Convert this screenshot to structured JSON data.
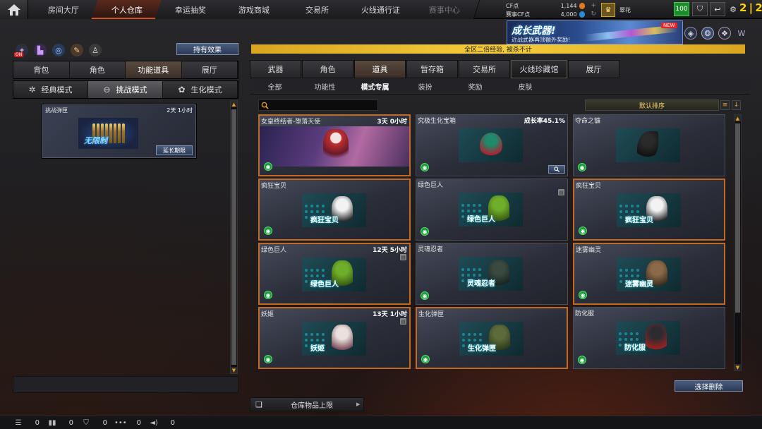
{
  "topnav": {
    "tabs": [
      {
        "label": "房间大厅"
      },
      {
        "label": "个人仓库"
      },
      {
        "label": "幸运抽奖"
      },
      {
        "label": "游戏商城"
      },
      {
        "label": "交易所"
      },
      {
        "label": "火线通行证"
      },
      {
        "label": "赛事中心"
      }
    ],
    "active_index": 1,
    "cf_label": "CF点",
    "cf_value": "1,144",
    "match_cf_label": "赛事CF点",
    "match_cf_value": "4,000",
    "username": "翠花",
    "level": "100",
    "counter": "2 | 2"
  },
  "banner": {
    "title": "成长武器!",
    "subtitle": "近战武器再顶额外奖励!",
    "new_tag": "NEW"
  },
  "ticker": "全区二倍经验, 被杀不计",
  "left": {
    "on_badge": "ON",
    "hold_button": "持有效果",
    "tabs": [
      "背包",
      "角色",
      "功能道具",
      "展厅"
    ],
    "active_tab": 2,
    "modes": [
      {
        "label": "经典模式",
        "icon": "classic-mode-icon",
        "glyph": "✲"
      },
      {
        "label": "挑战模式",
        "icon": "challenge-mode-icon",
        "glyph": "⊖"
      },
      {
        "label": "生化模式",
        "icon": "bio-mode-icon",
        "glyph": "✿"
      }
    ],
    "active_mode": 1,
    "item": {
      "name": "挑战弹匣",
      "time": "2天 1小时",
      "overlay": "无限制",
      "extend_button": "延长期限"
    }
  },
  "right": {
    "tabs": [
      "武器",
      "角色",
      "道具",
      "暂存箱",
      "交易所",
      "火线珍藏馆",
      "展厅"
    ],
    "active_tab": 2,
    "subtabs": [
      "全部",
      "功能性",
      "模式专属",
      "装扮",
      "奖励",
      "皮肤"
    ],
    "active_subtab": 2,
    "search_placeholder": "",
    "sort_label": "默认排序",
    "items": [
      {
        "name": "女皇终结者-堕落天使",
        "time": "3天 0小时",
        "highlight": true,
        "style": "wide",
        "caption": ""
      },
      {
        "name": "究极生化宝箱",
        "time": "成长率45.1%",
        "highlight": false,
        "style": "chest",
        "caption": "",
        "magnify": true
      },
      {
        "name": "夺命之镰",
        "time": "",
        "highlight": false,
        "style": "scythe",
        "caption": ""
      },
      {
        "name": "疯狂宝贝",
        "time": "",
        "highlight": true,
        "style": "char-pink",
        "caption": "疯狂宝贝"
      },
      {
        "name": "绿色巨人",
        "time": "",
        "highlight": false,
        "style": "char-green",
        "caption": "绿色巨人",
        "lock": true
      },
      {
        "name": "疯狂宝贝",
        "time": "",
        "highlight": true,
        "style": "char-pink",
        "caption": "疯狂宝贝"
      },
      {
        "name": "绿色巨人",
        "time": "12天 5小时",
        "highlight": true,
        "style": "char-green",
        "caption": "绿色巨人",
        "lock": true
      },
      {
        "name": "灵魂忍者",
        "time": "",
        "highlight": false,
        "style": "char-dark",
        "caption": "灵魂忍者"
      },
      {
        "name": "迷雾幽灵",
        "time": "",
        "highlight": true,
        "style": "char-brown",
        "caption": "迷雾幽灵"
      },
      {
        "name": "妖姬",
        "time": "13天 1小时",
        "highlight": true,
        "style": "char-white",
        "caption": "妖姬",
        "lock": true
      },
      {
        "name": "生化弹匣",
        "time": "",
        "highlight": true,
        "style": "ammo",
        "caption": "生化弹匣"
      },
      {
        "name": "防化服",
        "time": "",
        "highlight": false,
        "style": "suit",
        "caption": "防化服"
      }
    ],
    "delete_button": "选择删除",
    "capacity_label": "仓库物品上限"
  },
  "bottombar": [
    {
      "icon": "list-icon",
      "glyph": "☰",
      "value": "0"
    },
    {
      "icon": "binoculars-icon",
      "glyph": "▮▮",
      "value": "0"
    },
    {
      "icon": "shield-icon",
      "glyph": "⛉",
      "value": "0"
    },
    {
      "icon": "chat-icon",
      "glyph": "•••",
      "value": "0"
    },
    {
      "icon": "speaker-icon",
      "glyph": "◄)",
      "value": "0"
    }
  ],
  "colors": {
    "accent": "#c06a28",
    "ticker": "#f5cd3c",
    "button": "#2b3954"
  }
}
